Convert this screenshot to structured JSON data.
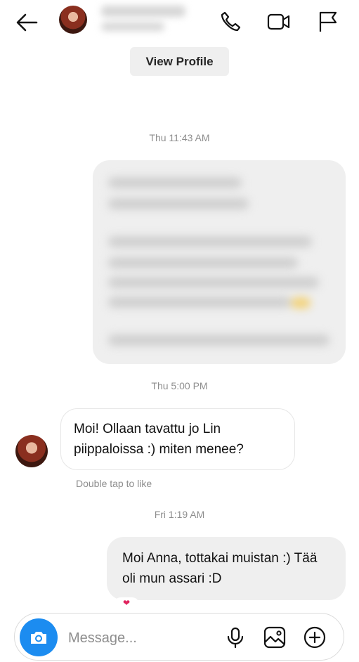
{
  "header": {
    "contact_name": "Anna",
    "icons": [
      "back-arrow-icon",
      "avatar",
      "phone-icon",
      "video-camera-icon",
      "flag-icon"
    ]
  },
  "view_profile_label": "View Profile",
  "thread": {
    "timestamp_1": "Thu 11:43 AM",
    "timestamp_2": "Thu 5:00 PM",
    "incoming_message": "Moi! Ollaan tavattu jo Lin piippaloissa :) miten menee?",
    "double_tap_hint": "Double tap to like",
    "timestamp_3": "Fri 1:19 AM",
    "outgoing_message": "Moi Anna, tottakai muistan :) Tää oli mun assari :D"
  },
  "composer": {
    "placeholder": "Message...",
    "icons": [
      "camera-icon",
      "microphone-icon",
      "gallery-icon",
      "add-circle-icon"
    ]
  },
  "colors": {
    "camera_button": "#1c8cf0",
    "bubble_gray": "#efefef",
    "timestamp_gray": "#8e8e8e"
  }
}
